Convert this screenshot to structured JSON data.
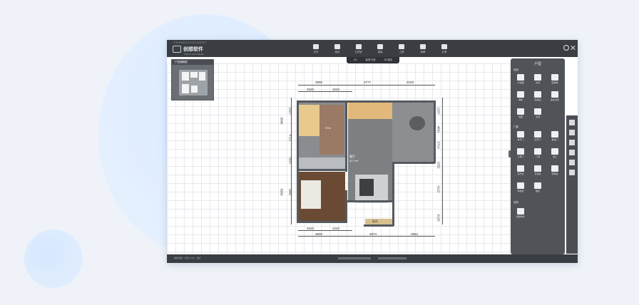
{
  "app": {
    "caption": "PERIMENSCHOLMSOFT",
    "brand_name": "创想软件",
    "brand_sub": "DSOFT SOFTWARE"
  },
  "toolbar": [
    {
      "label": "文件",
      "icon": "file-icon"
    },
    {
      "label": "保存",
      "icon": "save-icon"
    },
    {
      "label": "云同步",
      "icon": "cloud-icon"
    },
    {
      "label": "渲染",
      "icon": "render-icon"
    },
    {
      "label": "工具",
      "icon": "tools-icon"
    },
    {
      "label": "清单",
      "icon": "list-icon"
    },
    {
      "label": "分享",
      "icon": "share-icon"
    }
  ],
  "subtabs": [
    "2D",
    "装修方案",
    "3D漫游"
  ],
  "minimap": {
    "title": "户型缩略图"
  },
  "panel": {
    "title": "户型",
    "sections": [
      {
        "label": "绘制",
        "items": [
          "户型图",
          "房间",
          "画墙体",
          "墙体",
          "画线段",
          "画多边形",
          "地面",
          "房顶",
          "区域"
        ]
      },
      {
        "label": "门窗",
        "items": [
          "单开门",
          "双开门",
          "推拉门",
          "子母门",
          "门洞",
          "垭口",
          "双开窗",
          "普通窗",
          "转角窗",
          "落地窗",
          "飘窗",
          "百叶窗"
        ]
      },
      {
        "label": "结构",
        "items": [
          "横梁构件"
        ]
      }
    ]
  },
  "plan": {
    "dims_top_outer": [
      "3800",
      "3777",
      "3159"
    ],
    "dims_top_inner": [
      "2520",
      "1040"
    ],
    "dims_left": [
      "1507",
      "4669",
      "2714",
      "1692",
      "6059",
      "3982"
    ],
    "dims_right": [
      "1937",
      "4661",
      "2714",
      "1552",
      "4122",
      "6129"
    ],
    "dims_bottom_inner": [
      "2520",
      "1040"
    ],
    "dims_bottom_outer": [
      "3800",
      "3974",
      "2962"
    ],
    "room_labels": [
      "97m",
      "客厅",
      "41.7m²",
      "阳台"
    ]
  },
  "statusbar": {
    "text": "墙体绘制 · 比例 1:100 · 坐标"
  },
  "colors": {
    "titlebar": "#3a3d42",
    "panel": "#505459",
    "wood": "#d9b27a",
    "floor_gray": "#8a8c8f"
  }
}
